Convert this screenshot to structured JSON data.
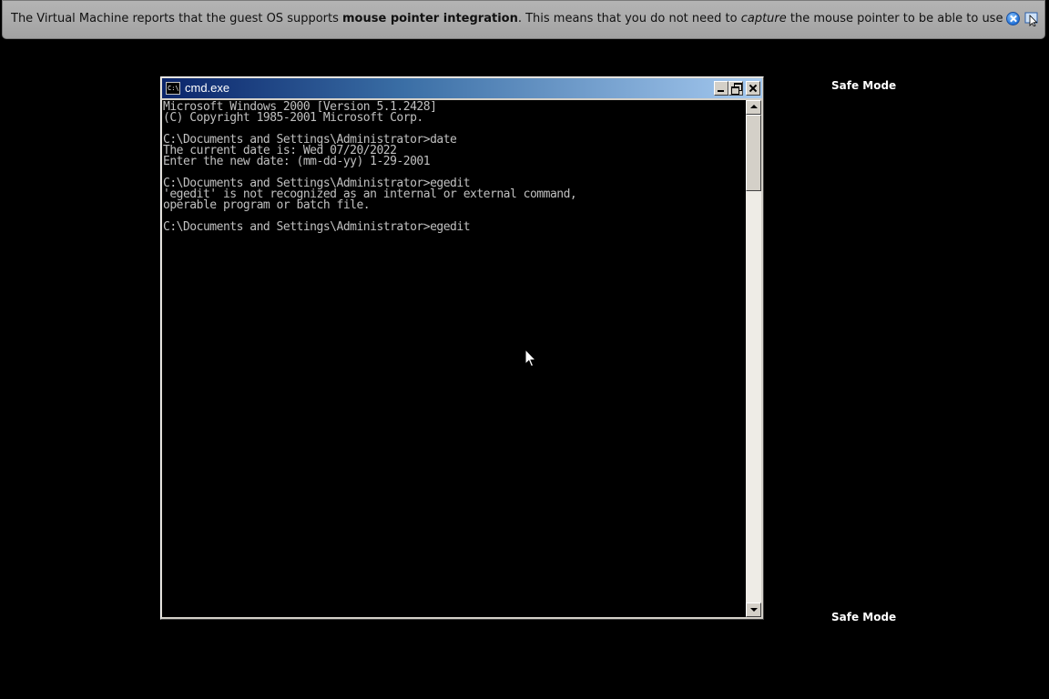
{
  "notification": {
    "text_before": "The Virtual Machine reports that the guest OS supports ",
    "bold": "mouse pointer integration",
    "text_middle": ". This means that you do not need to ",
    "italic": "capture",
    "text_after": " the mouse pointer to be able to use it in your guest OS --",
    "close_icon": "close-circle-icon",
    "mouse_icon": "mouse-integration-icon"
  },
  "safe_mode": {
    "top_label": "Safe Mode",
    "bottom_label": "Safe Mode"
  },
  "console": {
    "title": "cmd.exe",
    "icon_label": "C:\\",
    "lines": [
      "Microsoft Windows 2000 [Version 5.1.2428]",
      "(C) Copyright 1985-2001 Microsoft Corp.",
      "",
      "C:\\Documents and Settings\\Administrator>date",
      "The current date is: Wed 07/20/2022",
      "Enter the new date: (mm-dd-yy) 1-29-2001",
      "",
      "C:\\Documents and Settings\\Administrator>egedit",
      "'egedit' is not recognized as an internal or external command,",
      "operable program or batch file.",
      "",
      "C:\\Documents and Settings\\Administrator>egedit"
    ]
  },
  "colors": {
    "desktop_background": "#000000",
    "console_text": "#c0c0c0",
    "title_bar_start": "#0a246a",
    "title_bar_end": "#a6caf0",
    "notification_background": "#b0b0b0"
  }
}
